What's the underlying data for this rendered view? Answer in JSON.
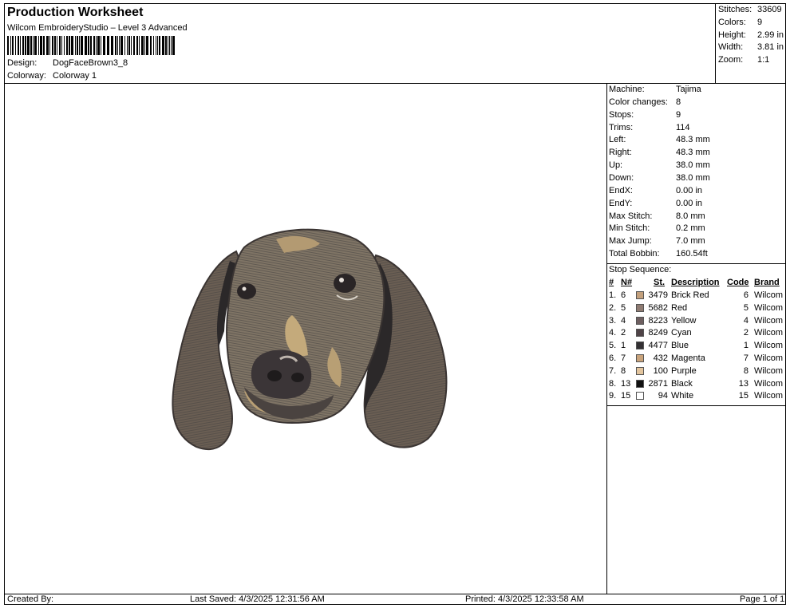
{
  "header": {
    "title": "Production Worksheet",
    "subtitle": "Wilcom EmbroideryStudio – Level 3 Advanced",
    "design_label": "Design:",
    "design_value": "DogFaceBrown3_8",
    "colorway_label": "Colorway:",
    "colorway_value": "Colorway 1"
  },
  "stats": {
    "stitches_label": "Stitches:",
    "stitches_value": "33609",
    "colors_label": "Colors:",
    "colors_value": "9",
    "height_label": "Height:",
    "height_value": "2.99 in",
    "width_label": "Width:",
    "width_value": "3.81 in",
    "zoom_label": "Zoom:",
    "zoom_value": "1:1"
  },
  "machine": {
    "rows": [
      {
        "label": "Machine:",
        "value": "Tajima"
      },
      {
        "label": "Color changes:",
        "value": "8"
      },
      {
        "label": "Stops:",
        "value": "9"
      },
      {
        "label": "Trims:",
        "value": "114"
      },
      {
        "label": "Left:",
        "value": "48.3 mm"
      },
      {
        "label": "Right:",
        "value": "48.3 mm"
      },
      {
        "label": "Up:",
        "value": "38.0 mm"
      },
      {
        "label": "Down:",
        "value": "38.0 mm"
      },
      {
        "label": "EndX:",
        "value": "0.00 in"
      },
      {
        "label": "EndY:",
        "value": "0.00 in"
      },
      {
        "label": "Max Stitch:",
        "value": "8.0 mm"
      },
      {
        "label": "Min Stitch:",
        "value": "0.2 mm"
      },
      {
        "label": "Max Jump:",
        "value": "7.0 mm"
      },
      {
        "label": "Total Bobbin:",
        "value": "160.54ft"
      }
    ]
  },
  "sequence": {
    "heading": "Stop Sequence:",
    "columns": {
      "num": "#",
      "n": "N#",
      "st": "St.",
      "desc": "Description",
      "code": "Code",
      "brand": "Brand"
    },
    "rows": [
      {
        "idx": "1.",
        "n": "6",
        "color": "#c3a07c",
        "st": "3479",
        "desc": "Brick Red",
        "code": "6",
        "brand": "Wilcom"
      },
      {
        "idx": "2.",
        "n": "5",
        "color": "#8f7b72",
        "st": "5682",
        "desc": "Red",
        "code": "5",
        "brand": "Wilcom"
      },
      {
        "idx": "3.",
        "n": "4",
        "color": "#6e5f60",
        "st": "8223",
        "desc": "Yellow",
        "code": "4",
        "brand": "Wilcom"
      },
      {
        "idx": "4.",
        "n": "2",
        "color": "#4f4347",
        "st": "8249",
        "desc": "Cyan",
        "code": "2",
        "brand": "Wilcom"
      },
      {
        "idx": "5.",
        "n": "1",
        "color": "#333033",
        "st": "4477",
        "desc": "Blue",
        "code": "1",
        "brand": "Wilcom"
      },
      {
        "idx": "6.",
        "n": "7",
        "color": "#c9a37b",
        "st": "432",
        "desc": "Magenta",
        "code": "7",
        "brand": "Wilcom"
      },
      {
        "idx": "7.",
        "n": "8",
        "color": "#e3c59e",
        "st": "100",
        "desc": "Purple",
        "code": "8",
        "brand": "Wilcom"
      },
      {
        "idx": "8.",
        "n": "13",
        "color": "#111111",
        "st": "2871",
        "desc": "Black",
        "code": "13",
        "brand": "Wilcom"
      },
      {
        "idx": "9.",
        "n": "15",
        "color": "#ffffff",
        "st": "94",
        "desc": "White",
        "code": "15",
        "brand": "Wilcom"
      }
    ]
  },
  "footer": {
    "created": "Created By:",
    "saved": "Last Saved: 4/3/2025 12:31:56 AM",
    "printed": "Printed: 4/3/2025 12:33:58 AM",
    "page": "Page 1 of 1"
  },
  "icons": {
    "design_preview": "dog-face-embroidery-image",
    "barcode": "barcode-image"
  }
}
